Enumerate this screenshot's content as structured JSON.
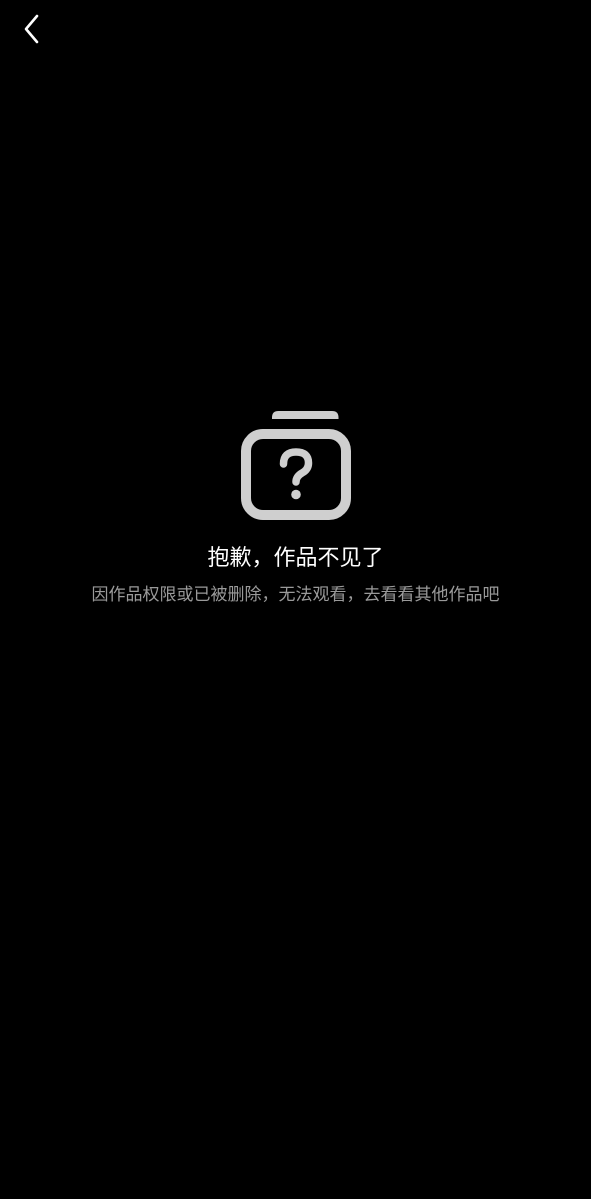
{
  "header": {
    "back_icon": "chevron-left-icon"
  },
  "empty_state": {
    "icon": "unknown-content-icon",
    "title": "抱歉，作品不见了",
    "message": "因作品权限或已被删除，无法观看，去看看其他作品吧"
  },
  "colors": {
    "background": "#000000",
    "title": "#ffffff",
    "message": "#9a9a9a",
    "icon": "#cfcfcf"
  }
}
